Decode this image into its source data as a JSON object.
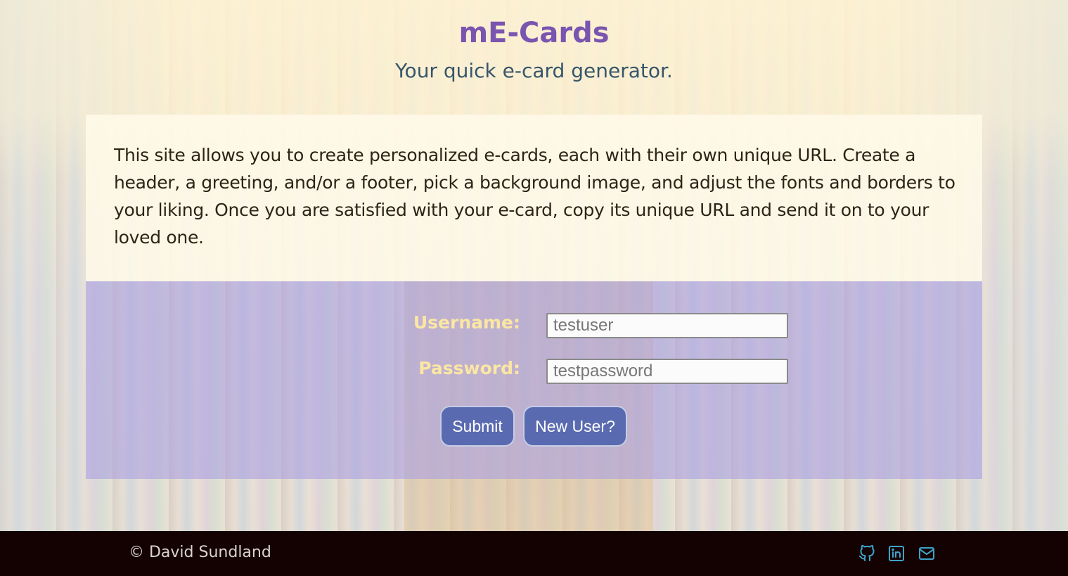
{
  "header": {
    "title": "mE-Cards",
    "subtitle": "Your quick e-card generator."
  },
  "intro": {
    "text": "This site allows you to create personalized e-cards, each with their own unique URL. Create a header, a greeting, and/or a footer, pick a background image, and adjust the fonts and borders to your liking. Once you are satisfied with your e-card, copy its unique URL and send it on to your loved one."
  },
  "login": {
    "username_label": "Username:",
    "username_value": "testuser",
    "password_label": "Password:",
    "password_value": "testpassword",
    "submit_label": "Submit",
    "new_user_label": "New User?"
  },
  "footer": {
    "copyright": "© David Sundland",
    "icons": [
      "github-icon",
      "linkedin-icon",
      "envelope-icon"
    ]
  },
  "colors": {
    "title": "#7a55b0",
    "subtitle": "#36566a",
    "label": "#fbe6a4",
    "button": "#5a6ab0",
    "footer_bg": "#140203",
    "icon": "#3ea3c9"
  }
}
